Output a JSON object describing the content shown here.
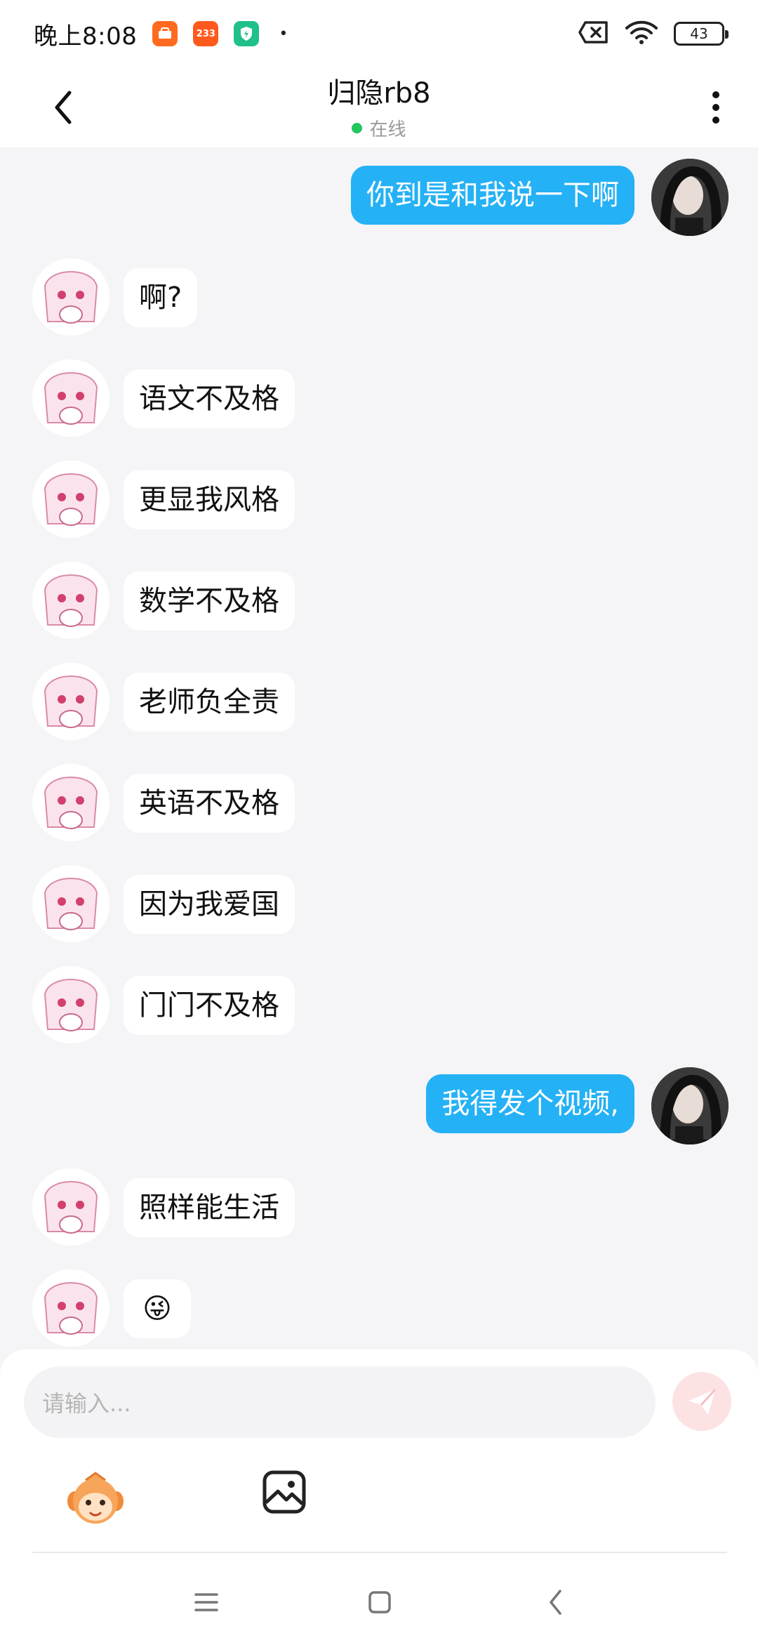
{
  "status_bar": {
    "time": "晚上8:08",
    "app_badges": [
      "mi-app-icon",
      "233-app-icon",
      "shield-app-icon"
    ],
    "badge_233_text": "233",
    "dot": "•",
    "battery": "43"
  },
  "header": {
    "title": "归隐rb8",
    "status": "在线"
  },
  "messages": [
    {
      "side": "right",
      "text": "你到是和我说一下啊"
    },
    {
      "side": "left",
      "text": "啊?"
    },
    {
      "side": "left",
      "text": "语文不及格"
    },
    {
      "side": "left",
      "text": "更显我风格"
    },
    {
      "side": "left",
      "text": "数学不及格"
    },
    {
      "side": "left",
      "text": "老师负全责"
    },
    {
      "side": "left",
      "text": "英语不及格"
    },
    {
      "side": "left",
      "text": "因为我爱国"
    },
    {
      "side": "left",
      "text": "门门不及格"
    },
    {
      "side": "right",
      "text": "我得发个视频,"
    },
    {
      "side": "left",
      "text": "照样能生活"
    },
    {
      "side": "left",
      "text": "😜"
    }
  ],
  "input": {
    "placeholder": "请输入..."
  },
  "colors": {
    "accent": "#25b1f5",
    "online": "#22c55e",
    "background": "#f5f5f7",
    "send_disabled": "#fde2e4"
  },
  "icons": {
    "back": "chevron-left-icon",
    "more": "more-vertical-icon",
    "send": "send-icon",
    "sticker": "sticker-icon",
    "image": "image-icon",
    "nav_menu": "menu-icon",
    "nav_home": "home-icon",
    "nav_back": "back-icon"
  }
}
